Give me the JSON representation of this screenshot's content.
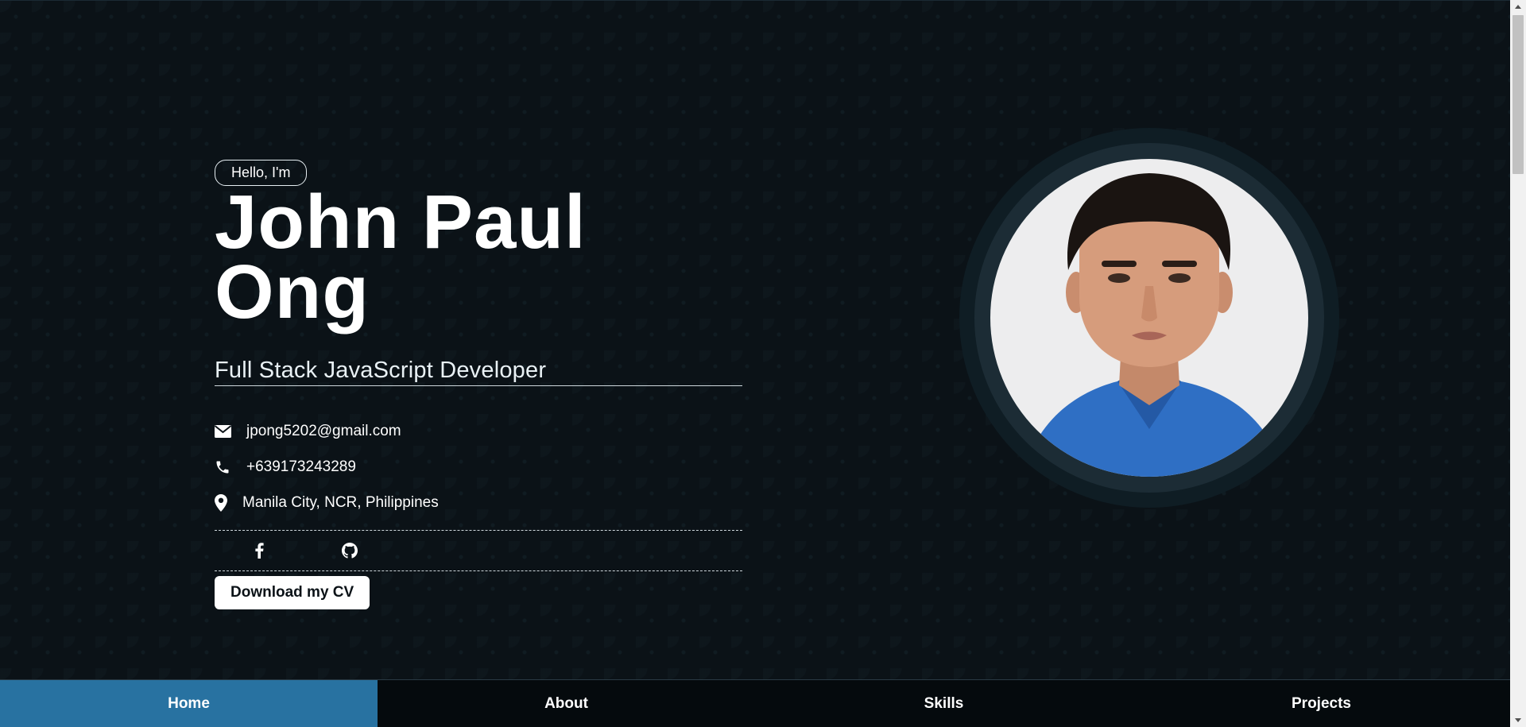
{
  "hero": {
    "greeting": "Hello, I'm",
    "name": "John Paul Ong",
    "headline": "Full Stack JavaScript Developer",
    "contacts": {
      "email": "jpong5202@gmail.com",
      "phone": "+639173243289",
      "location": "Manila City, NCR, Philippines"
    },
    "icons": {
      "email": "envelope-icon",
      "phone": "phone-icon",
      "location": "map-pin-icon"
    },
    "socials": [
      "facebook-icon",
      "github-icon"
    ],
    "cv_button": "Download my CV",
    "portrait_alt": "Portrait photo"
  },
  "nav": {
    "items": [
      {
        "label": "Home",
        "active": true
      },
      {
        "label": "About",
        "active": false
      },
      {
        "label": "Skills",
        "active": false
      },
      {
        "label": "Projects",
        "active": false
      }
    ]
  },
  "colors": {
    "background": "#0b1217",
    "nav_active": "#2872a1",
    "nav_bg": "#050a0d",
    "text": "#ffffff"
  }
}
